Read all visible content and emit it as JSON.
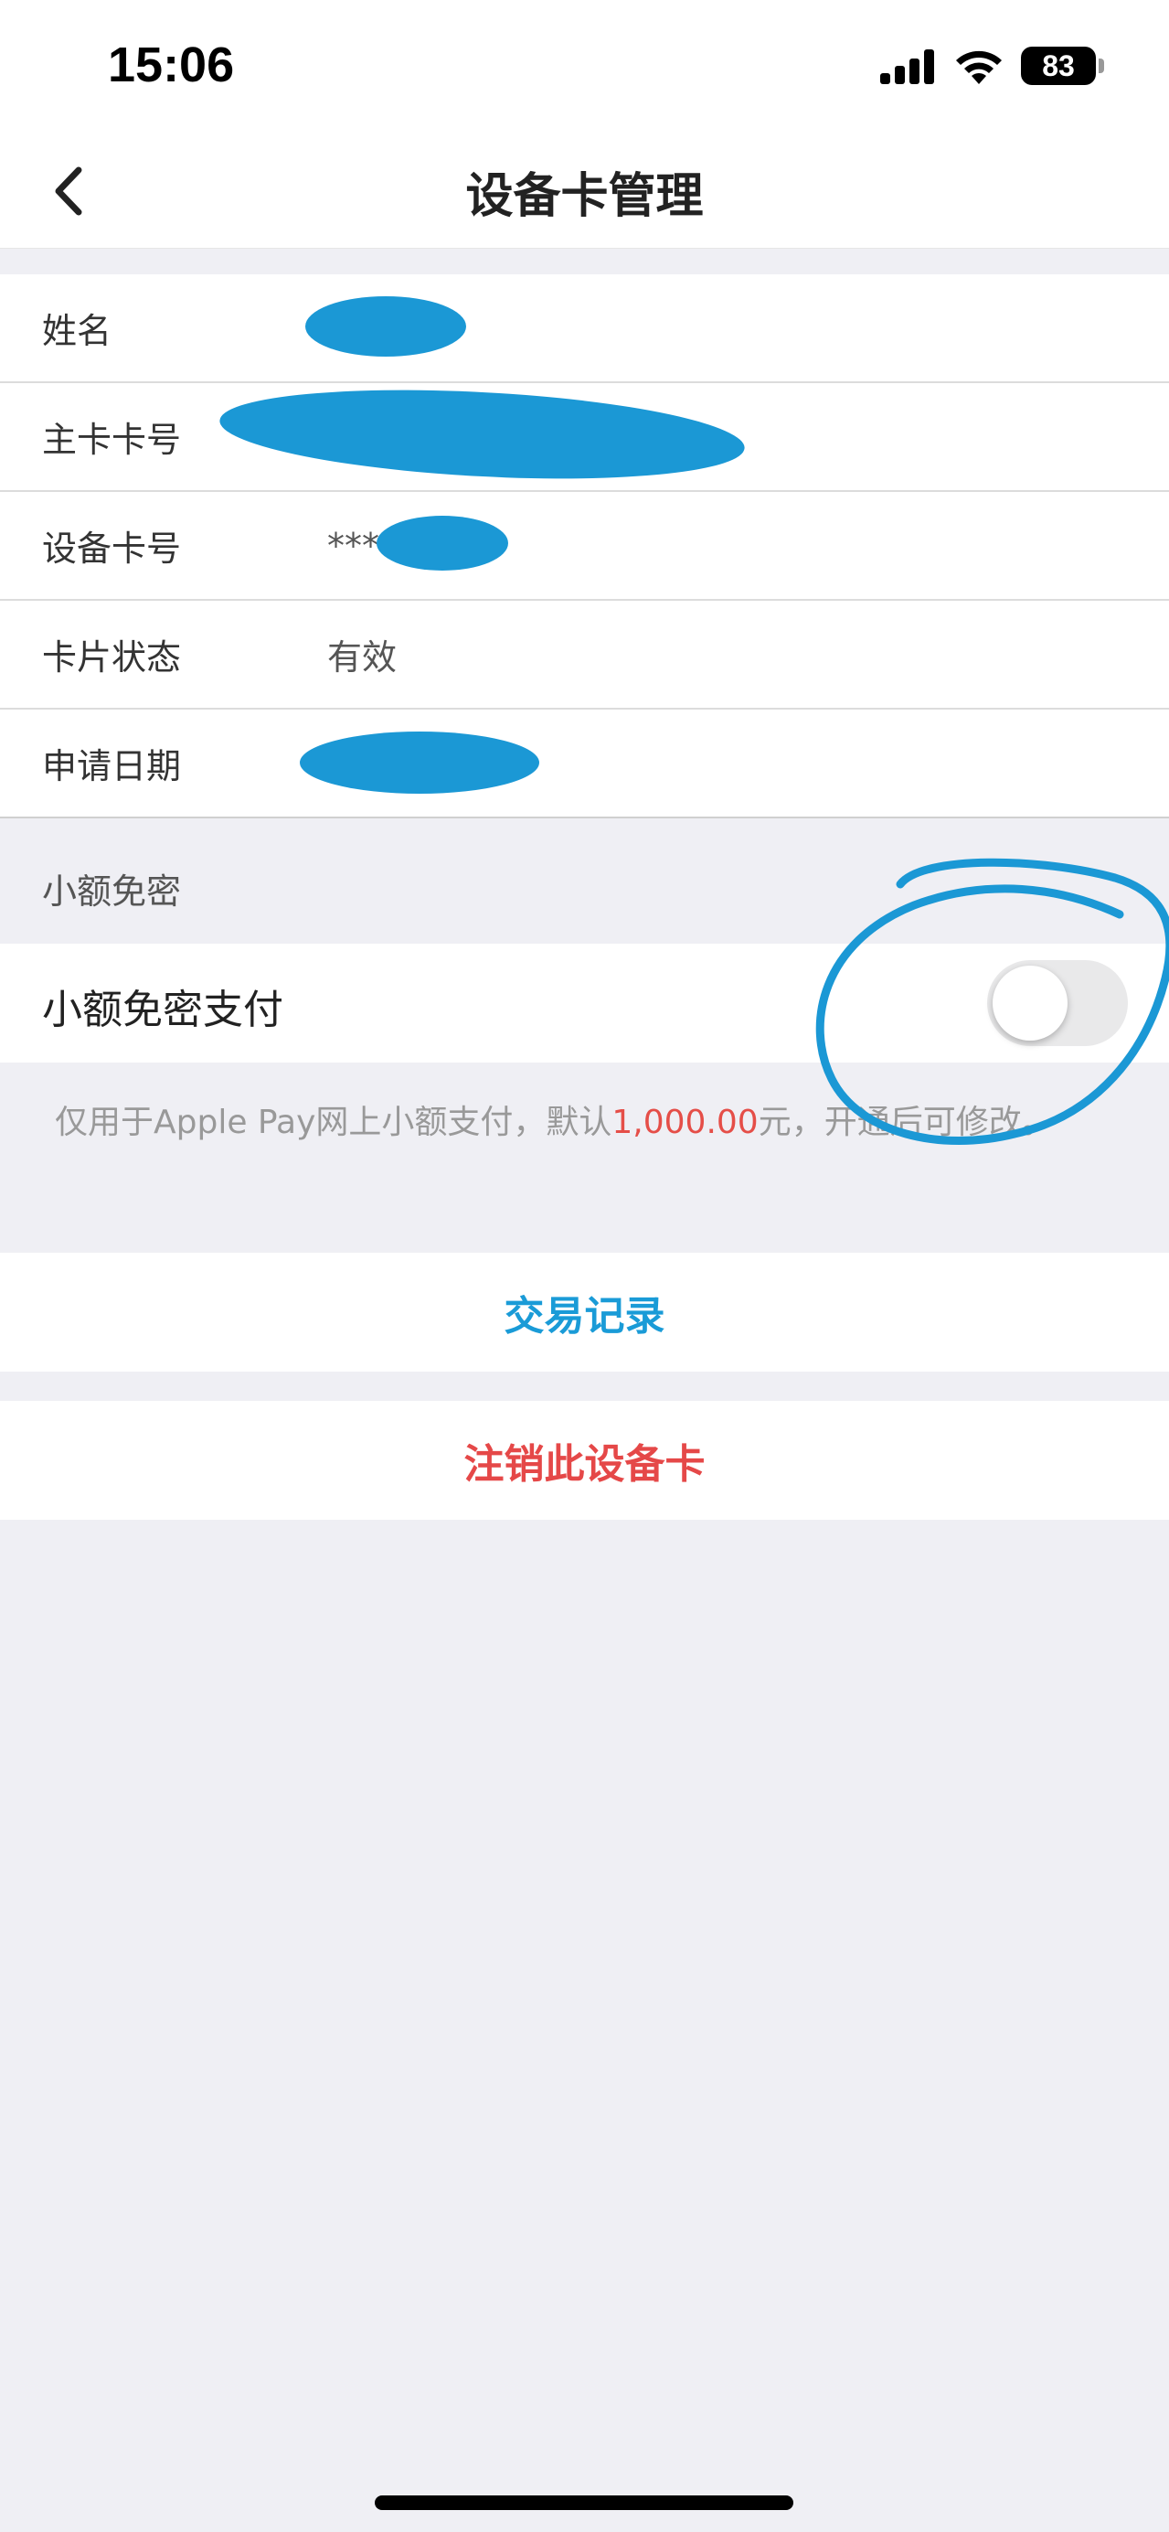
{
  "status_bar": {
    "time": "15:06",
    "battery": "83"
  },
  "nav": {
    "title": "设备卡管理",
    "back_icon": "chevron-left-icon"
  },
  "info": {
    "name_label": "姓名",
    "main_card_label": "主卡卡号",
    "device_card_label": "设备卡号",
    "device_card_value": "***",
    "status_label": "卡片状态",
    "status_value": "有效",
    "apply_date_label": "申请日期"
  },
  "small_pay": {
    "section_title": "小额免密",
    "toggle_label": "小额免密支付",
    "toggle_on": false,
    "hint_prefix": "仅用于Apple Pay网上小额支付，默认",
    "hint_amount": "1,000.00",
    "hint_suffix": "元，开通后可修改。"
  },
  "actions": {
    "records": "交易记录",
    "cancel": "注销此设备卡"
  },
  "colors": {
    "accent_blue": "#1a9bd7",
    "danger_red": "#e54848",
    "redact_blue": "#1b98d5"
  }
}
